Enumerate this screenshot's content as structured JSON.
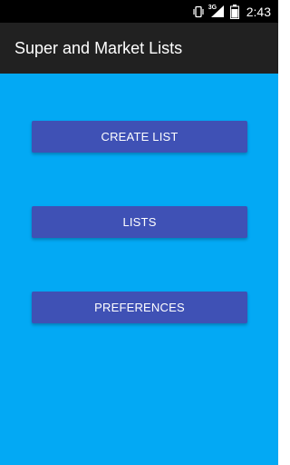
{
  "status_bar": {
    "network_label": "3G",
    "time": "2:43",
    "icons": [
      "vibrate-icon",
      "network-signal-icon",
      "battery-icon"
    ]
  },
  "app_bar": {
    "title": "Super and Market Lists",
    "background": "#212121"
  },
  "main": {
    "background": "#03a9f4",
    "button_color": "#3f51b5",
    "buttons": [
      {
        "label": "CREATE LIST"
      },
      {
        "label": "LISTS"
      },
      {
        "label": "PREFERENCES"
      }
    ]
  }
}
